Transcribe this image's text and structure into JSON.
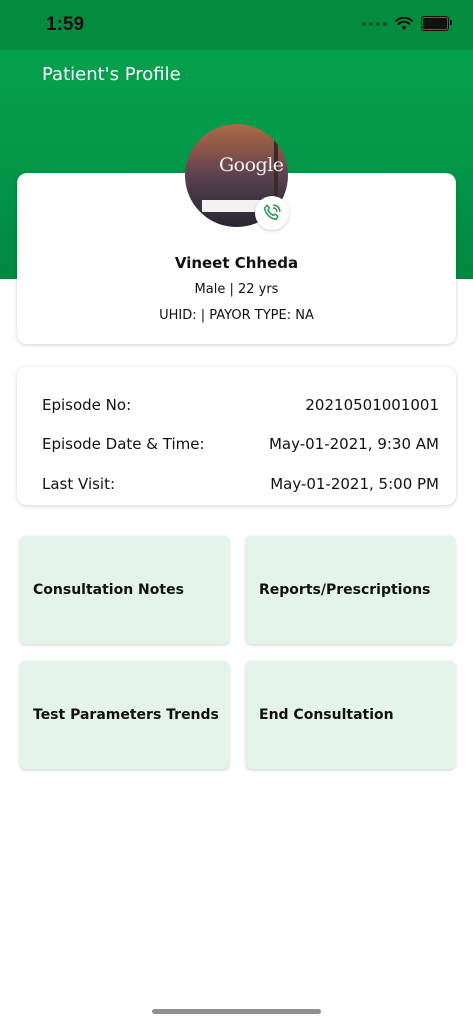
{
  "status_bar": {
    "time": "1:59"
  },
  "header": {
    "title": "Patient's Profile"
  },
  "patient": {
    "name": "Vineet Chheda",
    "gender_age": "Male | 22 yrs",
    "uhid_payor": "UHID:  | PAYOR TYPE: NA",
    "avatar_text": "Google"
  },
  "episode": {
    "rows": [
      {
        "label": "Episode No:",
        "value": "20210501001001"
      },
      {
        "label": "Episode Date & Time:",
        "value": "May-01-2021, 9:30 AM"
      },
      {
        "label": "Last Visit:",
        "value": "May-01-2021, 5:00 PM"
      }
    ]
  },
  "actions": [
    {
      "label": "Consultation Notes"
    },
    {
      "label": "Reports/Prescriptions"
    },
    {
      "label": "Test Parameters Trends"
    },
    {
      "label": "End Consultation"
    }
  ],
  "colors": {
    "brand_green": "#039a4a",
    "tile_bg": "#e5f4ea"
  }
}
